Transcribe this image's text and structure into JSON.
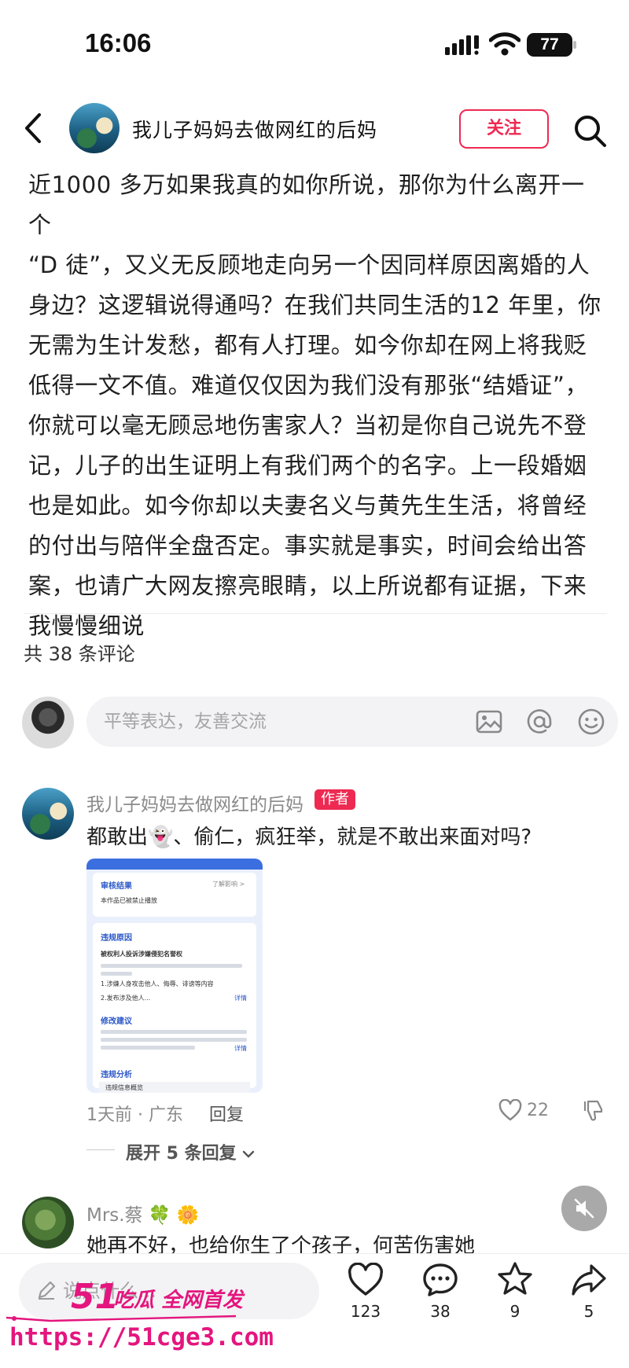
{
  "status_bar": {
    "time": "16:06",
    "battery": "77"
  },
  "header": {
    "title": "我儿子妈妈去做网红的后妈",
    "follow_label": "关注"
  },
  "post": {
    "lines": [
      "近1000 多万如果我真的如你所说，那你为什么离开一个",
      "“D 徒”，又义无反顾地走向另一个因同样原因离婚的人",
      "身边？这逻辑说得通吗？在我们共同生活的12 年里，你",
      "无需为生计发愁，都有人打理。如今你却在网上将我贬",
      "低得一文不值。难道仅仅因为我们没有那张“结婚证”，",
      "你就可以毫无顾忌地伤害家人？当初是你自己说先不登",
      "记，儿子的出生证明上有我们两个的名字。上一段婚姻",
      "也是如此。如今你却以夫妻名义与黄先生生活，将曾经",
      "的付出与陪伴全盘否定。事实就是事实，时间会给出答",
      "案，也请广大网友擦亮眼睛，以上所说都有证据，下来",
      "我慢慢细说"
    ]
  },
  "comments_header": {
    "count_text": "共 38 条评论"
  },
  "comment_input": {
    "placeholder": "平等表达，友善交流"
  },
  "comments": [
    {
      "name": "我儿子妈妈去做网红的后妈",
      "tag": "作者",
      "text_before": "都敢出",
      "emoji": "👻",
      "text_after": "、偷仁，疯狂举，就是不敢出来面对吗?",
      "time_location": "1天前 · 广东",
      "reply_label": "回复",
      "likes": "22",
      "expand_label": "展开 5 条回复",
      "image": {
        "section1_title": "审核结果",
        "section1_link": "了解影响 >",
        "section1_text": "本作品已被禁止播放",
        "section2_title": "违规原因",
        "section2_subtitle": "被权利人投诉涉嫌侵犯名誉权",
        "section2_items": [
          "1.涉嫌人身攻击他人、侮辱、诽谤等内容",
          "2.发布涉及他人..."
        ],
        "detail_label": "详情",
        "section3_title": "修改建议",
        "section4_title": "违规分析",
        "section4_sub": "违规信息概览"
      }
    },
    {
      "name": "Mrs.蔡",
      "name_emojis": "🍀 🌼",
      "text": "她再不好，也给你生了个孩子，何苦伤害她"
    }
  ],
  "bottom_bar": {
    "input_placeholder": "说点什么...",
    "like_count": "123",
    "comment_count": "38",
    "favorite_count": "9",
    "share_count": "5"
  },
  "watermark": {
    "logo_text": "51吃瓜 全网首发",
    "url": "https://51cge3.com"
  },
  "colors": {
    "accent": "#ee2a52",
    "watermark": "#e4157e"
  }
}
